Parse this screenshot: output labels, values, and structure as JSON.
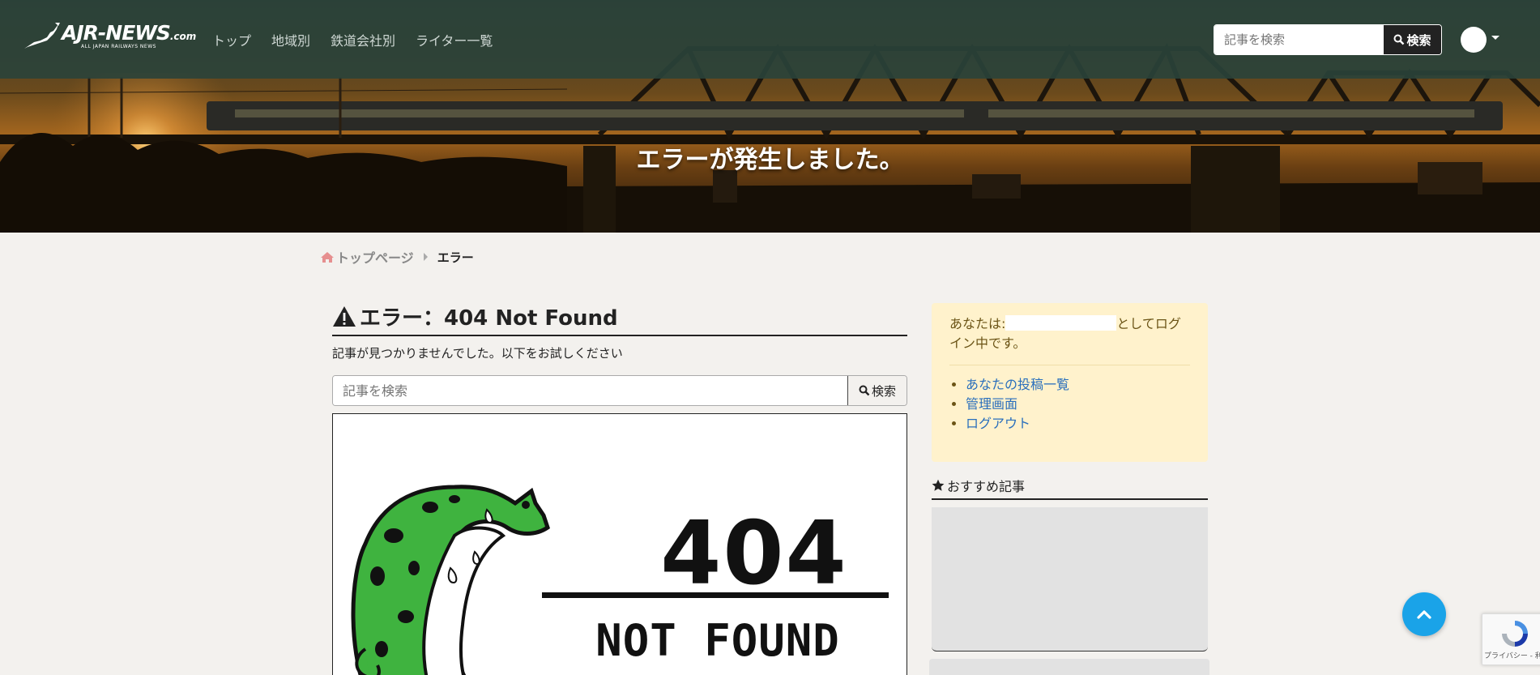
{
  "navbar": {
    "logo_text": "AJR-NEWS",
    "logo_suffix": ".com",
    "logo_subtitle": "ALL JAPAN RAILWAYS NEWS",
    "links": [
      "トップ",
      "地域別",
      "鉄道会社別",
      "ライター一覧"
    ],
    "search_placeholder": "記事を検索",
    "search_button": "検索"
  },
  "hero": {
    "title": "エラーが発生しました。"
  },
  "breadcrumb": {
    "home": "トップページ",
    "current": "エラー"
  },
  "main": {
    "error_title": "エラー：404 Not Found",
    "error_message": "記事が見つかりませんでした。以下をお試しください",
    "search_placeholder": "記事を検索",
    "search_button": "検索",
    "image_404": "404",
    "image_not_found": "NOT FOUND"
  },
  "sidebar": {
    "login_prefix": "あなたは:",
    "login_suffix": "としてログイン中です。",
    "links": [
      "あなたの投稿一覧",
      "管理画面",
      "ログアウト"
    ],
    "recommended_title": "おすすめ記事"
  },
  "recaptcha": {
    "label": "プライバシー - 利用規約"
  },
  "colors": {
    "navbar_bg": "#2a423a",
    "page_bg": "#f3f1ee",
    "login_box_bg": "#fff2cc",
    "link": "#2a6fbc",
    "to_top": "#1aa3e8",
    "gecko_green": "#3fb33f"
  }
}
